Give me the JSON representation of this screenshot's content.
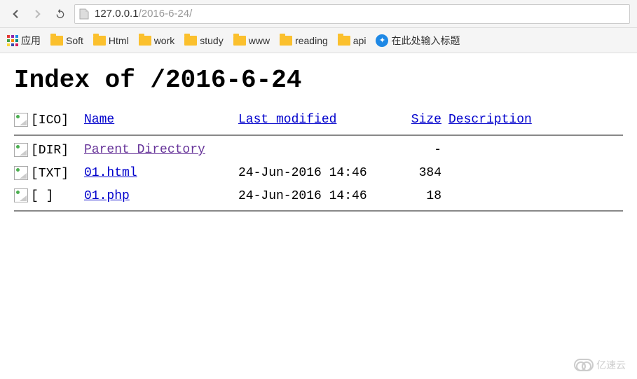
{
  "browser": {
    "url_host": "127.0.0.1",
    "url_path": "/2016-6-24/"
  },
  "bookmarks": {
    "apps": "应用",
    "items": [
      {
        "label": "Soft"
      },
      {
        "label": "Html"
      },
      {
        "label": "work"
      },
      {
        "label": "study"
      },
      {
        "label": "www"
      },
      {
        "label": "reading"
      },
      {
        "label": "api"
      }
    ],
    "placeholder": "在此处输入标题"
  },
  "page": {
    "title": "Index of /2016-6-24",
    "headers": {
      "name": "Name",
      "modified": "Last modified",
      "size": "Size",
      "description": "Description"
    },
    "icon_header_alt": "[ICO]",
    "rows": [
      {
        "alt": "[DIR]",
        "name": "Parent Directory",
        "modified": "",
        "size": "-",
        "visited": true
      },
      {
        "alt": "[TXT]",
        "name": "01.html",
        "modified": "24-Jun-2016 14:46",
        "size": "384",
        "visited": false
      },
      {
        "alt": "[  ]",
        "name": "01.php",
        "modified": "24-Jun-2016 14:46",
        "size": "18",
        "visited": false
      }
    ]
  },
  "watermark": "亿速云"
}
